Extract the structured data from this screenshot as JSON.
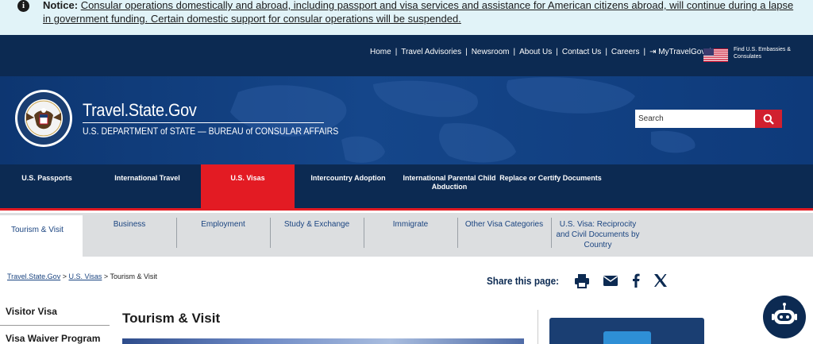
{
  "notice": {
    "label": "Notice:",
    "message": "Consular operations domestically and abroad, including passport and visa services and assistance for American citizens abroad, will continue during a lapse in government funding. Certain domestic support for consular operations will be suspended."
  },
  "utility_nav": {
    "items": [
      "Home",
      "Travel Advisories",
      "Newsroom",
      "About Us",
      "Contact Us",
      "Careers",
      "MyTravelGov"
    ],
    "embassy_link": "Find U.S. Embassies & Consulates"
  },
  "header": {
    "site_title": "Travel.State.Gov",
    "subtitle": "U.S. DEPARTMENT of STATE — BUREAU of CONSULAR AFFAIRS",
    "seal_text": "DEPARTMENT OF STATE · UNITED STATES OF AMERICA"
  },
  "search": {
    "placeholder": "Search"
  },
  "main_nav": {
    "items": [
      "U.S. Passports",
      "International Travel",
      "U.S. Visas",
      "Intercountry Adoption",
      "International Parental Child Abduction",
      "Replace or Certify Documents"
    ],
    "active": "U.S. Visas"
  },
  "sub_nav": {
    "items": [
      "Tourism & Visit",
      "Business",
      "Employment",
      "Study & Exchange",
      "Immigrate",
      "Other Visa Categories",
      "U.S. Visa: Reciprocity and Civil Documents by Country"
    ],
    "active": "Tourism & Visit"
  },
  "breadcrumb": {
    "links": [
      "Travel.State.Gov",
      "U.S. Visas"
    ],
    "separator": ">",
    "current": "Tourism & Visit"
  },
  "share": {
    "label": "Share this page:"
  },
  "sidebar": {
    "items": [
      "Visitor Visa",
      "Visa Waiver Program"
    ]
  },
  "page": {
    "title": "Tourism & Visit"
  },
  "colors": {
    "navy": "#0c2a52",
    "red": "#e31b23",
    "notice_bg": "#e1f3f8",
    "subnav_bg": "#dcdee0"
  }
}
